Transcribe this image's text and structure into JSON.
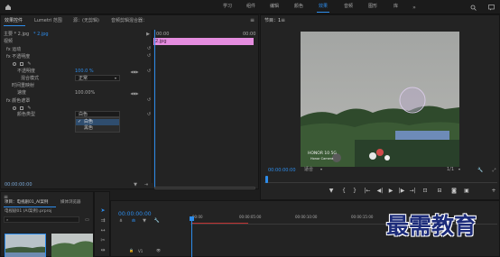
{
  "topbar": {
    "workspaces": [
      "学习",
      "组件",
      "编辑",
      "颜色",
      "效果",
      "音频",
      "图形",
      "库"
    ],
    "active": "效果"
  },
  "effects_panel": {
    "tabs": [
      "效果控件",
      "Lumetri 范围",
      "源：(无剪辑)",
      "音频剪辑混合器："
    ],
    "source": "主要 * 2.jpg",
    "clip": "* 2.jpg",
    "clip_time": "00:00",
    "clip_time_end": "00:00",
    "clip_bar_label": "2.jpg",
    "section_video": "视频",
    "motion": "fx 运动",
    "opacity": "fx 不透明度",
    "opacity_value_label": "不透明度",
    "opacity_value": "100.0 %",
    "blend_label": "混合模式",
    "blend_value": "正常",
    "time_remap": "时间重映射",
    "speed_label": "速度",
    "speed_value": "100.00%",
    "color_key": "fx 颜色遮罩",
    "key_color_label": "颜色类型",
    "dropdown_value": "白色",
    "dropdown_options": [
      "白色",
      "黑色"
    ],
    "bottom_time": "00:00:00:00"
  },
  "program_monitor": {
    "title": "节目：1",
    "timecode": "00:00:00:00",
    "fit": "适合",
    "scale": "1/1",
    "watermark": [
      "HONOR 10 5G",
      "Honor Camera"
    ]
  },
  "project_panel": {
    "tabs": [
      "项目：电视剧01_AI案例",
      "媒体浏览器"
    ],
    "project": "电视剧01 (AI案例).prproj"
  },
  "timeline": {
    "timecode": "00:00:00:00",
    "ruler": [
      "00:00",
      "00:00:05:00",
      "00:00:10:00",
      "00:00:15:00"
    ],
    "track_v1": "V1",
    "track_a1": "A1"
  },
  "logo": "最需教育",
  "colors": {
    "accent": "#2d8ceb",
    "clip_pink": "#e58ddf",
    "render_red": "#c03232",
    "bg": "#232323"
  }
}
